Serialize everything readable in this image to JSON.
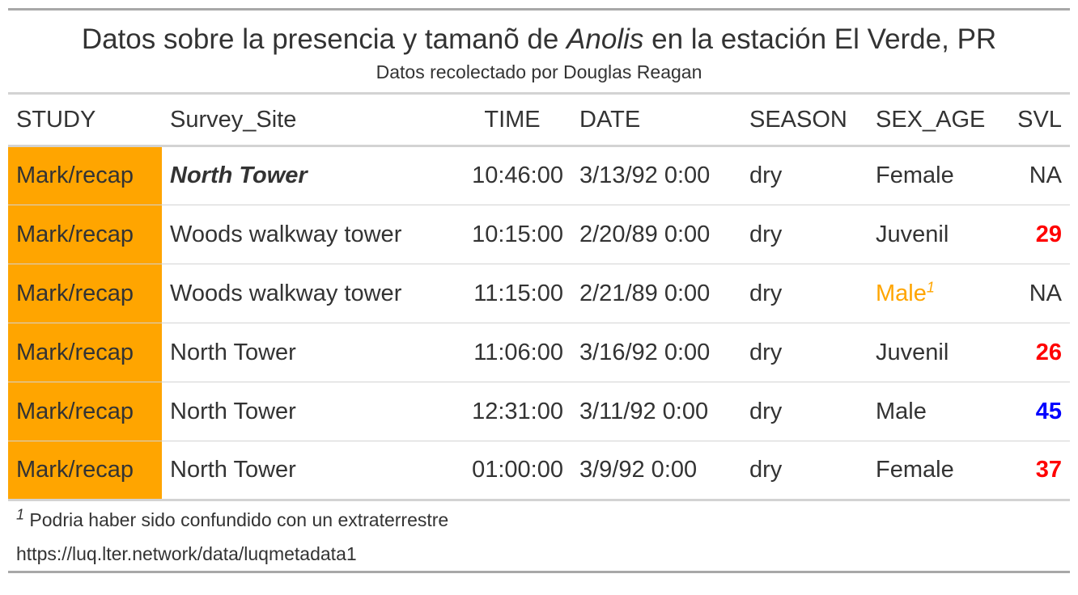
{
  "heading": {
    "title_before": "Datos sobre la presencia y tamanõ de ",
    "title_italic": "Anolis",
    "title_after": " en la estación El Verde, PR",
    "subtitle": "Datos recolectado por Douglas Reagan"
  },
  "columns": [
    "STUDY",
    "Survey_Site",
    "TIME",
    "DATE",
    "SEASON",
    "SEX_AGE",
    "SVL"
  ],
  "rows": [
    {
      "study": "Mark/recap",
      "site": "North Tower",
      "time": "10:46:00",
      "date": "3/13/92 0:00",
      "season": "dry",
      "sex_age": "Female",
      "footnote_mark": "",
      "svl": "NA"
    },
    {
      "study": "Mark/recap",
      "site": "Woods walkway tower",
      "time": "10:15:00",
      "date": "2/20/89 0:00",
      "season": "dry",
      "sex_age": "Juvenil",
      "footnote_mark": "",
      "svl": "29"
    },
    {
      "study": "Mark/recap",
      "site": "Woods walkway tower",
      "time": "11:15:00",
      "date": "2/21/89 0:00",
      "season": "dry",
      "sex_age": "Male",
      "footnote_mark": "1",
      "svl": "NA"
    },
    {
      "study": "Mark/recap",
      "site": "North Tower",
      "time": "11:06:00",
      "date": "3/16/92 0:00",
      "season": "dry",
      "sex_age": "Juvenil",
      "footnote_mark": "",
      "svl": "26"
    },
    {
      "study": "Mark/recap",
      "site": "North Tower",
      "time": "12:31:00",
      "date": "3/11/92 0:00",
      "season": "dry",
      "sex_age": "Male",
      "footnote_mark": "",
      "svl": "45"
    },
    {
      "study": "Mark/recap",
      "site": "North Tower",
      "time": "01:00:00",
      "date": "3/9/92 0:00",
      "season": "dry",
      "sex_age": "Female",
      "footnote_mark": "",
      "svl": "37"
    }
  ],
  "styles": {
    "study_fill": "#FFA500",
    "highlight_text": "#FFA500",
    "svl_red": "#FF0000",
    "svl_blue": "#0000FF",
    "text": "#333333"
  },
  "footnote": {
    "mark": "1",
    "text": " Podria haber sido confundido con un extraterrestre"
  },
  "source_note": "https://luq.lter.network/data/luqmetadata1"
}
